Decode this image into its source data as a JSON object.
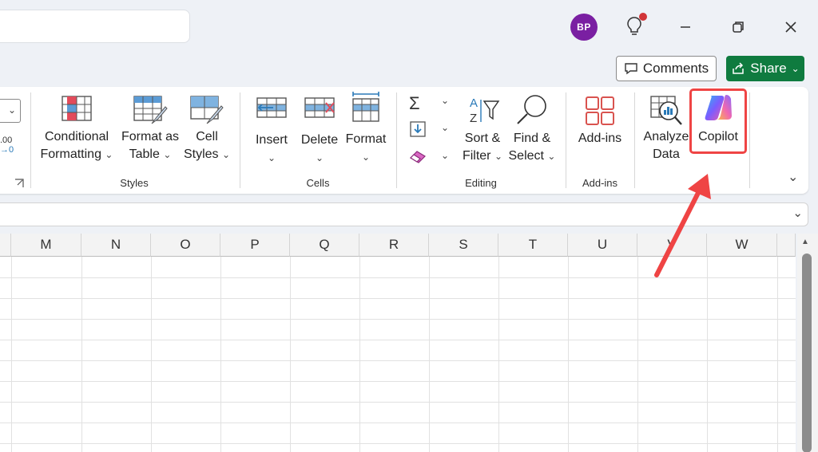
{
  "titlebar": {
    "avatar_initials": "BP",
    "icons": [
      "lightbulb-icon",
      "minimize-icon",
      "restore-icon",
      "close-icon"
    ]
  },
  "actions": {
    "comments_label": "Comments",
    "share_label": "Share"
  },
  "ribbon": {
    "partial_left": {
      "number_format_glyph": ".00",
      "number_format_glyph2": "→0"
    },
    "styles": {
      "group_label": "Styles",
      "conditional_formatting": [
        "Conditional",
        "Formatting"
      ],
      "format_as_table": [
        "Format as",
        "Table"
      ],
      "cell_styles": [
        "Cell",
        "Styles"
      ]
    },
    "cells": {
      "group_label": "Cells",
      "insert": "Insert",
      "delete": "Delete",
      "format": "Format"
    },
    "editing": {
      "group_label": "Editing",
      "sort_filter": [
        "Sort &",
        "Filter"
      ],
      "find_select": [
        "Find &",
        "Select"
      ]
    },
    "addins": {
      "group_label": "Add-ins",
      "addins": "Add-ins"
    },
    "analysis": {
      "analyze_data": [
        "Analyze",
        "Data"
      ],
      "copilot": "Copilot"
    }
  },
  "sheet": {
    "columns": [
      "M",
      "N",
      "O",
      "P",
      "Q",
      "R",
      "S",
      "T",
      "U",
      "V",
      "W"
    ]
  },
  "colors": {
    "share_green": "#0f7b3f",
    "avatar_purple": "#7a1fa2",
    "highlight_red": "#ef4444"
  }
}
